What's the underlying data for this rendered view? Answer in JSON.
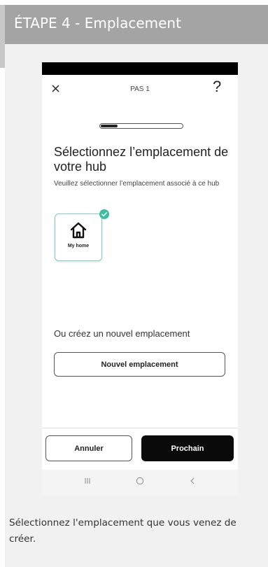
{
  "step": {
    "title": "ÉTAPE 4 - Emplacement"
  },
  "phone": {
    "top_bar": {
      "step_label": "PAS 1",
      "help_label": "?"
    },
    "progress": {
      "fraction": 0.2
    },
    "title": "Sélectionnez l’emplacement de votre hub",
    "subtitle": "Veuillez sélectionner l’emplacement associé à ce hub",
    "location_card": {
      "label": "My home",
      "selected": true,
      "accent_color": "#3cbf9f"
    },
    "or_create_text": "Ou créez un nouvel emplacement",
    "new_location_button": "Nouvel emplacement",
    "cancel_button": "Annuler",
    "next_button": "Prochain"
  },
  "caption": "Sélectionnez l'emplacement que vous venez de créer."
}
